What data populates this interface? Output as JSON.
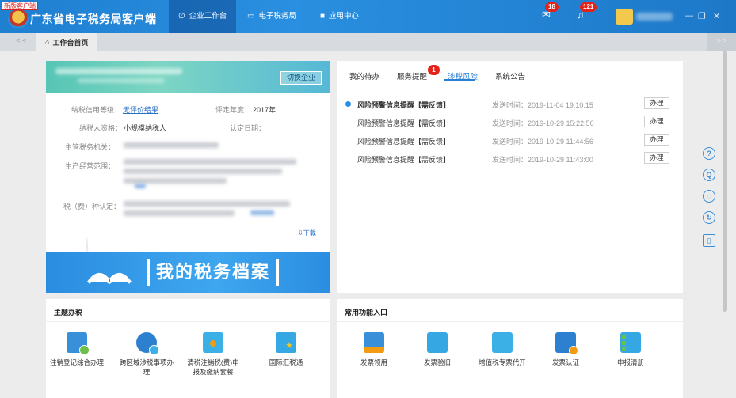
{
  "header": {
    "new_badge": "新版客户端",
    "app_title": "广东省电子税务局客户端",
    "nav": [
      {
        "icon": "∅",
        "label": "企业工作台"
      },
      {
        "icon": "▭",
        "label": "电子税务局"
      },
      {
        "icon": "■",
        "label": "应用中心"
      }
    ],
    "notif_messages": "18",
    "notif_bell": "121",
    "win_min": "—",
    "win_restore": "❐",
    "win_close": "✕"
  },
  "tabs": {
    "prev": "< <",
    "next": "> >",
    "home_label": "工作台首页"
  },
  "company": {
    "switch_label": "切换企业",
    "credit_label": "纳税信用等级：",
    "credit_value": "无评价结果",
    "year_label": "评定年度：",
    "year_value": "2017年",
    "qualification_label": "纳税人资格：",
    "qualification_value": "小规模纳税人",
    "confirm_date_label": "认定日期：",
    "confirm_date_value": "",
    "authority_label": "主管税务机关：",
    "scope_label": "生产经营范围：",
    "tax_type_label": "税（费）种认定：",
    "download_label": "下载"
  },
  "archive": {
    "text": "我的税务档案"
  },
  "messages": {
    "tabs": [
      "我的待办",
      "服务提醒",
      "涉税风险",
      "系统公告"
    ],
    "active_tab": "涉税风险",
    "service_badge": "1",
    "action_label": "办理",
    "items": [
      {
        "title": "风险预警信息提醒【需反馈】",
        "time": "发送时间：2019-11-04 19:10:15",
        "unread": true
      },
      {
        "title": "风险预警信息提醒【需反馈】",
        "time": "发送时间：2019-10-29 15:22:56",
        "unread": false
      },
      {
        "title": "风险预警信息提醒【需反馈】",
        "time": "发送时间：2019-10-29 11:44:56",
        "unread": false
      },
      {
        "title": "风险预警信息提醒【需反馈】",
        "time": "发送时间：2019-10-29 11:43:00",
        "unread": false
      }
    ]
  },
  "topics": {
    "title": "主题办税",
    "items": [
      {
        "label": "注销登记综合办理",
        "icon": "document-icon",
        "color": "#3a8fd9"
      },
      {
        "label": "跨区域涉税事项办理",
        "icon": "globe-tax-icon",
        "color": "#2d7fd0"
      },
      {
        "label": "清税注销税(费)申报及缴纳套餐",
        "icon": "window-icon",
        "color": "#3ab0e6"
      },
      {
        "label": "国际汇税通",
        "icon": "doc-star-icon",
        "color": "#35a7e3"
      }
    ]
  },
  "common": {
    "title": "常用功能入口",
    "items": [
      {
        "label": "发票领用",
        "icon": "hand-doc-icon",
        "color": "#3a8fd9"
      },
      {
        "label": "发票验旧",
        "icon": "list-old-icon",
        "color": "#35a7e3"
      },
      {
        "label": "增值税专票代开",
        "icon": "special-invoice-icon",
        "color": "#3ab0e6"
      },
      {
        "label": "发票认证",
        "icon": "list-check-icon",
        "color": "#2d7fd0"
      },
      {
        "label": "申报清册",
        "icon": "list-icon",
        "color": "#35a7e3"
      }
    ]
  },
  "float_tools": [
    "?",
    "Q",
    "◌",
    "↻",
    "▯"
  ]
}
